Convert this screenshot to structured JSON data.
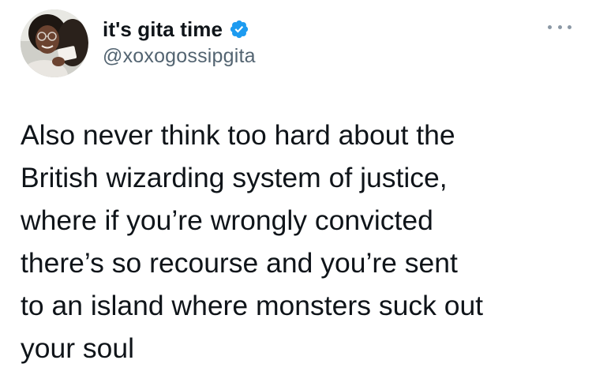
{
  "author": {
    "display_name": "it's gita time",
    "handle": "@xoxogossipgita",
    "verified": true,
    "avatar_icon": "profile-photo"
  },
  "tweet": {
    "text": "Also never think too hard about the\nBritish wizarding system of justice,\nwhere if you’re wrongly convicted\nthere’s so recourse and you’re sent\nto an island where monsters suck out\nyour soul"
  },
  "icons": {
    "verified": "verified-badge-icon",
    "more": "more-options-icon"
  },
  "colors": {
    "text": "#0f1419",
    "handle": "#536471",
    "verified": "#1d9bf0",
    "more_dots": "#8b98a5"
  }
}
